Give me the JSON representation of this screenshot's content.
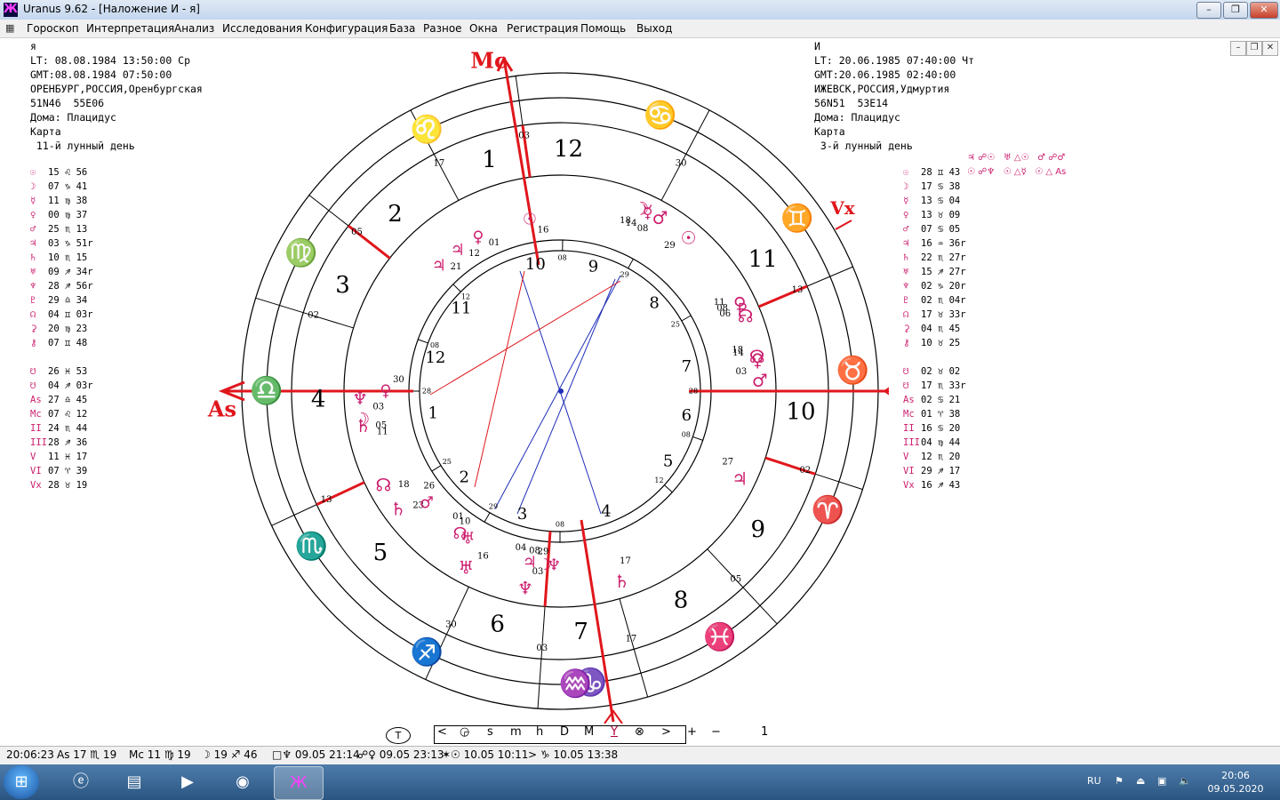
{
  "window": {
    "title": "Uranus 9.62 - [Наложение И - я]",
    "app_icon": "Ж"
  },
  "menu": [
    "Гороскоп",
    "Интерпретация",
    "Анализ",
    "Исследования",
    "Конфигурация",
    "База",
    "Разное",
    "Окна",
    "Регистрация",
    "Помощь",
    "Выход"
  ],
  "left_info": [
    "я",
    "LT: 08.08.1984 13:50:00 Ср",
    "GMT:08.08.1984 07:50:00",
    "ОРЕНБУРГ,РОССИЯ,Оренбургская",
    "51N46  55E06",
    "Дома: Плацидус",
    "Карта",
    " 11-й лунный день"
  ],
  "right_info": [
    "И",
    "LT: 20.06.1985 07:40:00 Чт",
    "GMT:20.06.1985 02:40:00",
    "ИЖЕВСК,РОССИЯ,Удмуртия",
    "56N51  53E14",
    "Дома: Плацидус",
    "Карта",
    " 3-й лунный день"
  ],
  "left_planets": [
    [
      "☉",
      "15 ♌ 56"
    ],
    [
      "☽",
      "07 ♑ 41"
    ],
    [
      "☿",
      "11 ♍ 38"
    ],
    [
      "♀",
      "00 ♍ 37"
    ],
    [
      "♂",
      "25 ♏ 13"
    ],
    [
      "♃",
      "03 ♑ 51r"
    ],
    [
      "♄",
      "10 ♏ 15"
    ],
    [
      "♅",
      "09 ♐ 34r"
    ],
    [
      "♆",
      "28 ♐ 56r"
    ],
    [
      "♇",
      "29 ♎ 34"
    ],
    [
      "☊",
      "04 ♊ 03r"
    ],
    [
      "⚳",
      "20 ♍ 23"
    ],
    [
      "⚷",
      "07 ♊ 48"
    ]
  ],
  "left_points": [
    [
      "☋",
      "26 ♓ 53"
    ],
    [
      "☋",
      "04 ♐ 03r"
    ],
    [
      "As",
      "27 ♎ 45"
    ],
    [
      "Mc",
      "07 ♌ 12"
    ],
    [
      "II",
      "24 ♏ 44"
    ],
    [
      "III",
      "28 ♐ 36"
    ],
    [
      "V",
      "11 ♓ 17"
    ],
    [
      "VI",
      "07 ♈ 39"
    ],
    [
      "Vx",
      "28 ♉ 19"
    ]
  ],
  "right_planets": [
    [
      "☉",
      "28 ♊ 43"
    ],
    [
      "☽",
      "17 ♋ 38"
    ],
    [
      "☿",
      "13 ♋ 04"
    ],
    [
      "♀",
      "13 ♉ 09"
    ],
    [
      "♂",
      "07 ♋ 05"
    ],
    [
      "♃",
      "16 ♒ 36r"
    ],
    [
      "♄",
      "22 ♏ 27r"
    ],
    [
      "♅",
      "15 ♐ 27r"
    ],
    [
      "♆",
      "02 ♑ 20r"
    ],
    [
      "♇",
      "02 ♏ 04r"
    ],
    [
      "☊",
      "17 ♉ 33r"
    ],
    [
      "⚳",
      "04 ♏ 45"
    ],
    [
      "⚷",
      "10 ♉ 25"
    ]
  ],
  "right_points": [
    [
      "☋",
      "02 ♉ 02"
    ],
    [
      "☋",
      "17 ♏ 33r"
    ],
    [
      "As",
      "02 ♋ 21"
    ],
    [
      "Mc",
      "01 ♈ 38"
    ],
    [
      "II",
      "16 ♋ 20"
    ],
    [
      "III",
      "04 ♍ 44"
    ],
    [
      "V",
      "12 ♏ 20"
    ],
    [
      "VI",
      "29 ♐ 17"
    ],
    [
      "Vx",
      "16 ♐ 43"
    ]
  ],
  "aspects_header": [
    "♃ ☍☉   ♅ △☉   ♂ ☍♂",
    "☉ ☍♆   ☉ △☿   ☉ △ As"
  ],
  "chart": {
    "axis_labels": {
      "mc": "Mc",
      "as": "As",
      "vx": "Vx"
    },
    "zodiac": [
      {
        "g": "♌",
        "a": 117
      },
      {
        "g": "♋",
        "a": 70
      },
      {
        "g": "♍",
        "a": 152
      },
      {
        "g": "♊",
        "a": 36
      },
      {
        "g": "♎",
        "a": 180
      },
      {
        "g": "♉",
        "a": 4
      },
      {
        "g": "♏",
        "a": 212
      },
      {
        "g": "♈",
        "a": -24
      },
      {
        "g": "♐",
        "a": 243
      },
      {
        "g": "♓",
        "a": -57
      },
      {
        "g": "♑",
        "a": 276
      },
      {
        "g": "♒",
        "a": -87
      }
    ],
    "outer_houses": [
      {
        "n": "1",
        "a": 107
      },
      {
        "n": "12",
        "a": 88
      },
      {
        "n": "2",
        "a": 133
      },
      {
        "n": "3",
        "a": 154
      },
      {
        "n": "4",
        "a": 182
      },
      {
        "n": "5",
        "a": 222
      },
      {
        "n": "6",
        "a": 255
      },
      {
        "n": "7",
        "a": 275
      },
      {
        "n": "8",
        "a": 300
      },
      {
        "n": "9",
        "a": 325
      },
      {
        "n": "10",
        "a": -5
      },
      {
        "n": "11",
        "a": 33
      }
    ],
    "outer_cusp_degrees": [
      {
        "t": "03",
        "a": 98
      },
      {
        "t": "17",
        "a": 118
      },
      {
        "t": "05",
        "a": 142
      },
      {
        "t": "02",
        "a": 163
      },
      {
        "t": "13",
        "a": 205
      },
      {
        "t": "30",
        "a": 245
      },
      {
        "t": "03",
        "a": 266
      },
      {
        "t": "17",
        "a": 286
      },
      {
        "t": "05",
        "a": 313
      },
      {
        "t": "02",
        "a": 342
      },
      {
        "t": "13",
        "a": 23
      },
      {
        "t": "30",
        "a": 62
      }
    ],
    "inner_houses": [
      {
        "n": "9",
        "a": 75
      },
      {
        "n": "10",
        "a": 101
      },
      {
        "n": "11",
        "a": 140
      },
      {
        "n": "12",
        "a": 165
      },
      {
        "n": "1",
        "a": 190
      },
      {
        "n": "2",
        "a": 222
      },
      {
        "n": "3",
        "a": 253
      },
      {
        "n": "4",
        "a": 291
      },
      {
        "n": "5",
        "a": 327
      },
      {
        "n": "6",
        "a": 349
      },
      {
        "n": "7",
        "a": 11
      },
      {
        "n": "8",
        "a": 43
      }
    ],
    "inner_cusp_degrees": [
      {
        "t": "08",
        "a": 89
      },
      {
        "t": "29",
        "a": 61
      },
      {
        "t": "12",
        "a": 135
      },
      {
        "t": "08",
        "a": 160
      },
      {
        "t": "28",
        "a": 180
      },
      {
        "t": "25",
        "a": 212
      },
      {
        "t": "29",
        "a": 240
      },
      {
        "t": "08",
        "a": 270
      },
      {
        "t": "12",
        "a": 318
      },
      {
        "t": "08",
        "a": 341
      },
      {
        "t": "28",
        "a": 0
      },
      {
        "t": "25",
        "a": 30
      }
    ],
    "outer_planets": [
      {
        "g": "☽",
        "d": "18",
        "a": 66
      },
      {
        "g": "♂",
        "d": "08",
        "a": 60
      },
      {
        "g": "☿",
        "d": "14",
        "a": 64
      },
      {
        "g": "☉",
        "d": "29",
        "a": 50
      },
      {
        "g": "♀",
        "d": "11",
        "a": 26
      },
      {
        "g": "♇",
        "d": "08",
        "a": 24
      },
      {
        "g": "☊",
        "d": "06",
        "a": 22
      },
      {
        "g": "☊",
        "d": "18",
        "a": 10
      },
      {
        "g": "♀",
        "d": "14",
        "a": 9
      },
      {
        "g": "♂",
        "d": "03",
        "a": 3
      },
      {
        "g": "♃",
        "d": "27",
        "a": -26
      },
      {
        "g": "♄",
        "d": "17",
        "a": -72
      },
      {
        "g": "♆",
        "d": "03",
        "a": -100
      },
      {
        "g": "♅",
        "d": "16",
        "a": -118
      },
      {
        "g": "♄",
        "d": "23",
        "a": -144
      },
      {
        "g": "☊",
        "d": "18",
        "a": -152
      },
      {
        "g": "♄",
        "d": "11",
        "a": -170
      },
      {
        "g": "☽",
        "d": "05",
        "a": -172
      },
      {
        "g": "♆",
        "d": "03",
        "a": -178
      }
    ],
    "inner_planets": [
      {
        "g": "☉",
        "d": "16",
        "a": 100
      },
      {
        "g": "♀",
        "d": "01",
        "a": 118
      },
      {
        "g": "♃",
        "d": "12",
        "a": 126
      },
      {
        "g": "♃",
        "d": "21",
        "a": 134
      },
      {
        "g": "♀",
        "d": "30",
        "a": 180
      },
      {
        "g": "♂",
        "d": "26",
        "a": -140
      },
      {
        "g": "☊",
        "d": "01",
        "a": -125
      },
      {
        "g": "♅",
        "d": "10",
        "a": -122
      },
      {
        "g": "♃",
        "d": "04",
        "a": -100
      },
      {
        "g": "♆",
        "d": "29",
        "a": -92
      },
      {
        "g": "☽",
        "d": "08",
        "a": -95
      }
    ]
  },
  "nav": {
    "t": "T",
    "items": [
      "<",
      "◶",
      "s",
      "m",
      "h",
      "D",
      "M",
      "Y",
      "⊗",
      ">"
    ],
    "selected": "Y",
    "plus": "+",
    "minus": "−",
    "step": "1"
  },
  "status": [
    "20:06:23",
    "As 17 ♏ 19",
    "Mc 11 ♍ 19",
    "☽ 19 ♐ 46",
    "□♆ 09.05 21:14",
    "☍♀ 09.05 23:13",
    "✶☉ 10.05 10:11",
    "> ♑ 10.05 13:38"
  ],
  "taskbar": {
    "lang": "RU",
    "time": "20:06",
    "date": "09.05.2020"
  }
}
